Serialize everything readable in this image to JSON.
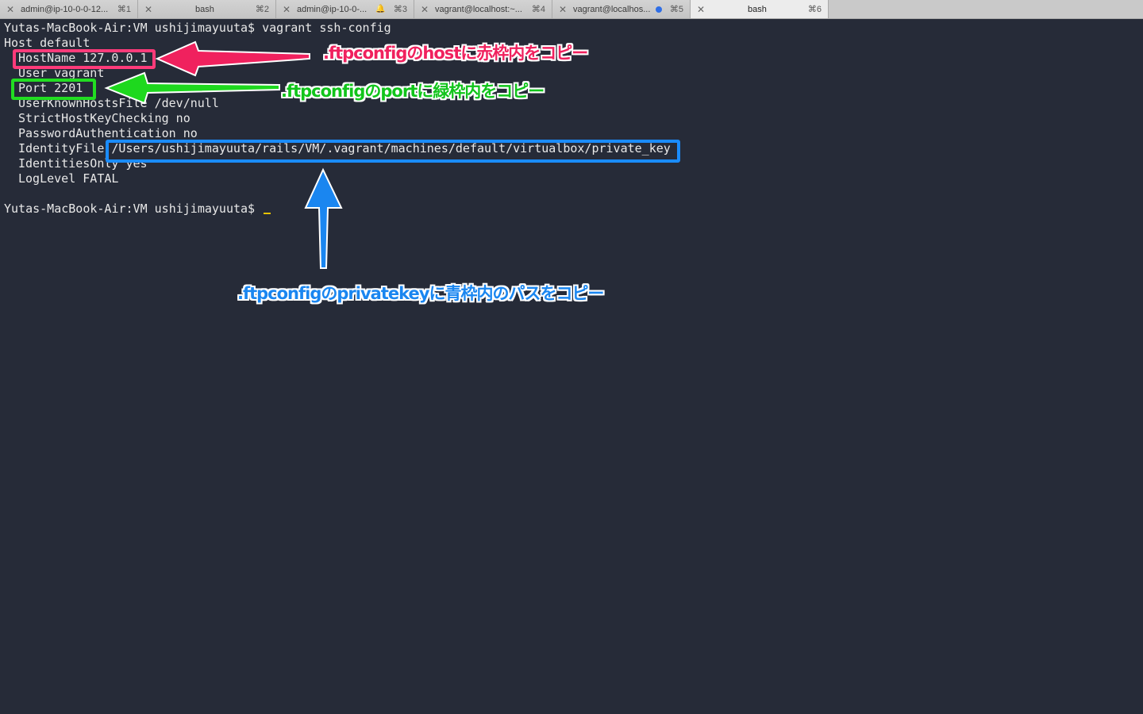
{
  "tabs": [
    {
      "title": "admin@ip-10-0-0-12...",
      "shortcut": "⌘1"
    },
    {
      "title": "bash",
      "shortcut": "⌘2"
    },
    {
      "title": "admin@ip-10-0-...",
      "shortcut": "⌘3"
    },
    {
      "title": "vagrant@localhost:~...",
      "shortcut": "⌘4"
    },
    {
      "title": "vagrant@localhos...",
      "shortcut": "⌘5"
    },
    {
      "title": "bash",
      "shortcut": "⌘6"
    }
  ],
  "terminal": {
    "prompt": "Yutas-MacBook-Air:VM ushijimayuuta$",
    "command": "vagrant ssh-config",
    "lines": [
      "Host default",
      "HostName 127.0.0.1",
      "User vagrant",
      "Port 2201",
      "UserKnownHostsFile /dev/null",
      "StrictHostKeyChecking no",
      "PasswordAuthentication no",
      "IdentityFile /Users/ushijimayuuta/rails/VM/.vagrant/machines/default/virtualbox/private_key",
      "IdentitiesOnly yes",
      "LogLevel FATAL"
    ]
  },
  "annotations": {
    "red": ".ftpconfigのhostに赤枠内をコピー",
    "green": ".ftpconfigのportに緑枠内をコピー",
    "blue": ".ftpconfigのprivatekeyに青枠内のパスをコピー"
  },
  "colors": {
    "red": "#ff3b7a",
    "green": "#22dd22",
    "blue": "#1a8cff",
    "background": "#262b38",
    "cursor": "#e6c200"
  },
  "icons": {
    "tab_close": "close-icon",
    "tab3_status": "bell-icon",
    "tab5_status": "activity-dot-icon"
  }
}
